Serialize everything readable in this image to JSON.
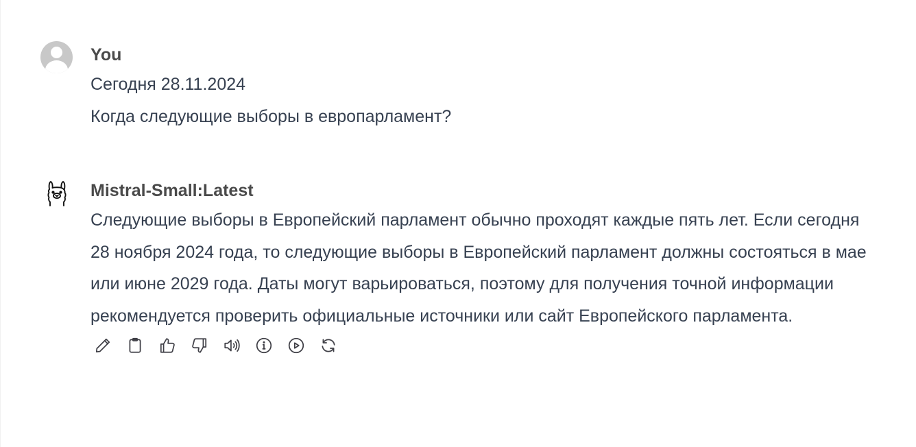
{
  "messages": {
    "user": {
      "author": "You",
      "lines": [
        "Сегодня 28.11.2024",
        "Когда следующие выборы в европарламент?"
      ]
    },
    "assistant": {
      "author": "Mistral-Small:Latest",
      "text": "Следующие выборы в Европейский парламент обычно проходят каждые пять лет. Если сегодня 28 ноября 2024 года, то следующие выборы в Европейский парламент должны состояться в мае или июне 2029 года. Даты могут варьироваться, поэтому для получения точной информации рекомендуется проверить официальные источники или сайт Европейского парламента."
    }
  },
  "actions": [
    {
      "icon": "pencil-icon",
      "name": "edit-button"
    },
    {
      "icon": "clipboard-icon",
      "name": "copy-button"
    },
    {
      "icon": "thumbs-up-icon",
      "name": "good-response-button"
    },
    {
      "icon": "thumbs-down-icon",
      "name": "bad-response-button"
    },
    {
      "icon": "speaker-icon",
      "name": "read-aloud-button"
    },
    {
      "icon": "info-icon",
      "name": "generation-info-button"
    },
    {
      "icon": "play-circle-icon",
      "name": "continue-response-button"
    },
    {
      "icon": "refresh-icon",
      "name": "regenerate-button"
    }
  ],
  "colors": {
    "text": "#374151",
    "author": "#4a4a4a",
    "avatar_bg": "#c8c8c8",
    "icon": "#3f3f46"
  }
}
